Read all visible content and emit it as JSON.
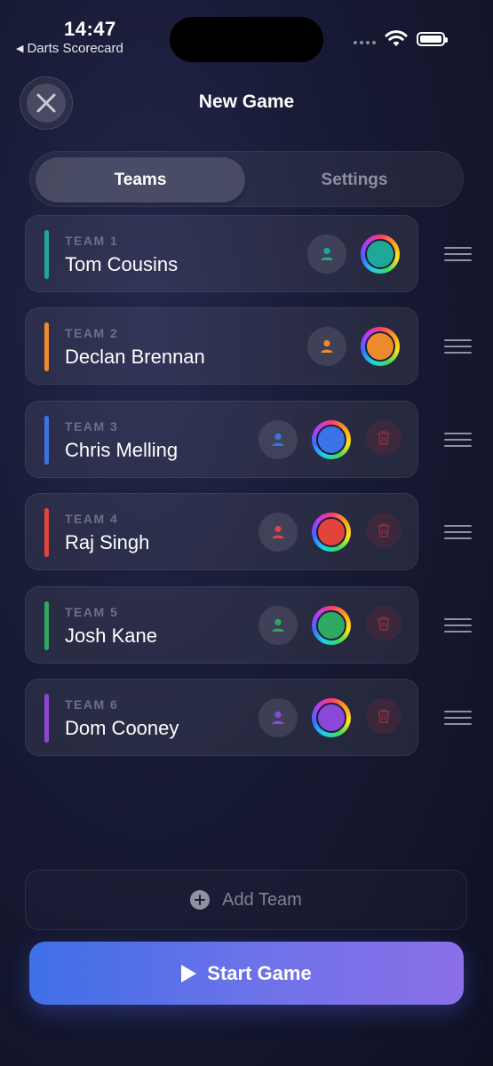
{
  "status_bar": {
    "time": "14:47",
    "back_app": "Darts Scorecard"
  },
  "header": {
    "title": "New Game"
  },
  "tabs": [
    {
      "label": "Teams",
      "active": true
    },
    {
      "label": "Settings",
      "active": false
    }
  ],
  "teams": [
    {
      "label": "TEAM 1",
      "name": "Tom Cousins",
      "color": "#1fa89a",
      "deletable": false
    },
    {
      "label": "TEAM 2",
      "name": "Declan Brennan",
      "color": "#ec8a2c",
      "deletable": false
    },
    {
      "label": "TEAM 3",
      "name": "Chris Melling",
      "color": "#3b74e6",
      "deletable": true
    },
    {
      "label": "TEAM 4",
      "name": "Raj Singh",
      "color": "#e2443c",
      "deletable": true
    },
    {
      "label": "TEAM 5",
      "name": "Josh Kane",
      "color": "#2ea960",
      "deletable": true
    },
    {
      "label": "TEAM 6",
      "name": "Dom Cooney",
      "color": "#8b48d8",
      "deletable": true
    }
  ],
  "add_team_label": "Add Team",
  "start_game_label": "Start Game",
  "icons": {
    "close": "close-icon",
    "person": "person-icon",
    "trash": "trash-icon",
    "drag": "drag-handle-icon",
    "plus": "plus-circle-icon",
    "play": "play-icon"
  }
}
